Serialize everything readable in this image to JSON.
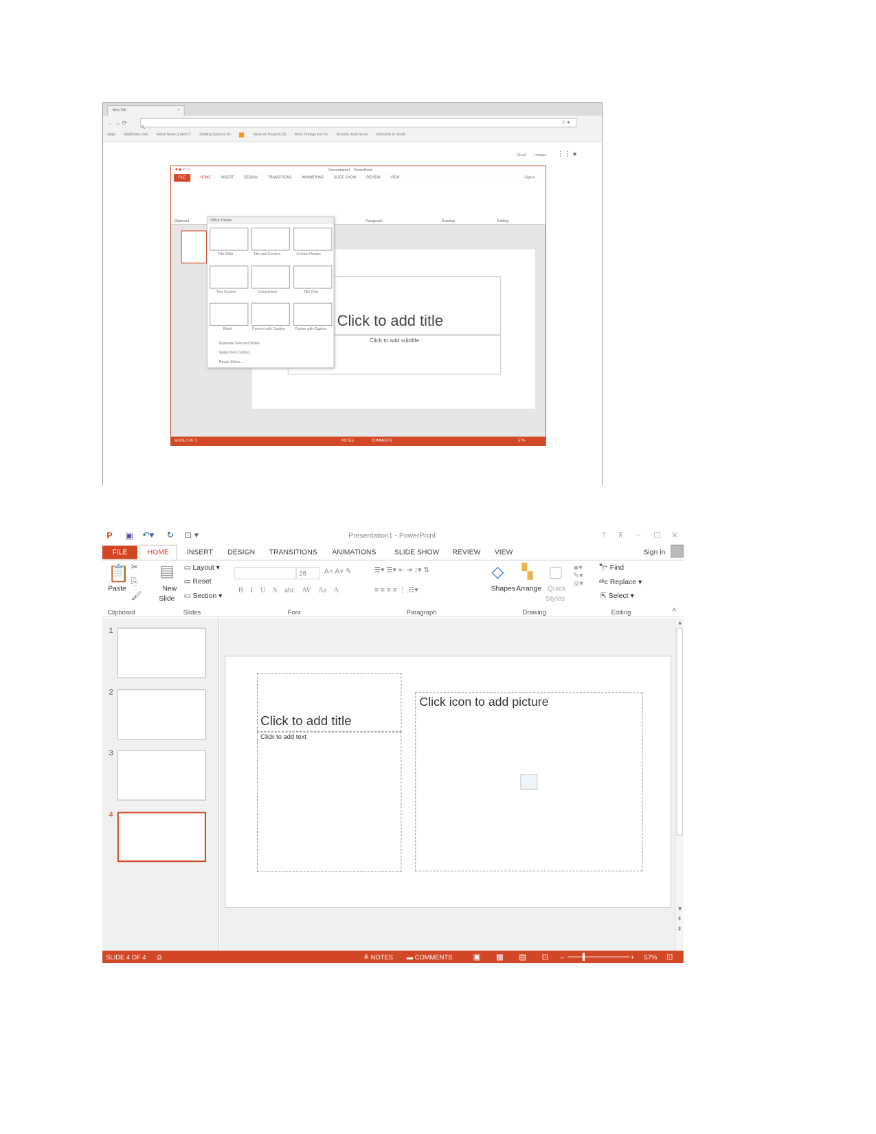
{
  "browser": {
    "tab_title": "New Tab",
    "bookmarks": [
      "Apps",
      "MailTester.com",
      "Retail News (Latest T",
      "Starting Quizzes for",
      "",
      "News on Projects (3)",
      "Mom Timings For Fo",
      "Security must be an",
      "Welcome to South"
    ],
    "links": [
      "Gmail",
      "Images"
    ]
  },
  "ppt_small": {
    "title": "Presentation1 - PowerPoint",
    "tabs": [
      "FILE",
      "HOME",
      "INSERT",
      "DESIGN",
      "TRANSITIONS",
      "ANIMATIONS",
      "SLIDE SHOW",
      "REVIEW",
      "VIEW"
    ],
    "sign_in": "Sign in",
    "gallery_header": "Office Theme",
    "layouts": [
      "Title Slide",
      "Title and Content",
      "Section Header",
      "Two Content",
      "Comparison",
      "Title Only",
      "Blank",
      "Content with Caption",
      "Picture with Caption"
    ],
    "menu": [
      "Duplicate Selected Slides",
      "Slides from Outline...",
      "Reuse Slides..."
    ],
    "slide_title": "Click to add title",
    "slide_subtitle": "Click to add subtitle",
    "status": "SLIDE 1 OF 1",
    "notes": "NOTES",
    "comments": "COMMENTS",
    "zoom": "57%",
    "groups": [
      "Clipboard",
      "Paragraph",
      "Drawing",
      "Editing"
    ]
  },
  "ppt": {
    "title": "Presentation1 - PowerPoint",
    "tabs": [
      "FILE",
      "HOME",
      "INSERT",
      "DESIGN",
      "TRANSITIONS",
      "ANIMATIONS",
      "SLIDE SHOW",
      "REVIEW",
      "VIEW"
    ],
    "active_tab": "HOME",
    "sign_in": "Sign in",
    "ribbon": {
      "paste": "Paste",
      "new_slide": "New",
      "new_slide2": "Slide",
      "layout": "Layout",
      "reset": "Reset",
      "section": "Section",
      "font_size": "28",
      "font_btns": [
        "B",
        "I",
        "U",
        "S",
        "abc",
        "AV",
        "Aa",
        "A"
      ],
      "shapes": "Shapes",
      "arrange": "Arrange",
      "quick": "Quick",
      "styles": "Styles",
      "find": "Find",
      "replace": "Replace",
      "select": "Select"
    },
    "groups": [
      "Clipboard",
      "Slides",
      "Font",
      "Paragraph",
      "Drawing",
      "Editing"
    ],
    "slides": [
      "1",
      "2",
      "3",
      "4"
    ],
    "selected_slide": 4,
    "slide": {
      "title": "Click to add title",
      "text": "Click to add text",
      "picture": "Click icon to add picture"
    },
    "status": {
      "slide": "SLIDE 4 OF 4",
      "notes": "NOTES",
      "comments": "COMMENTS",
      "zoom": "57%",
      "zoom_value": 57
    },
    "accent": "#d24726"
  }
}
